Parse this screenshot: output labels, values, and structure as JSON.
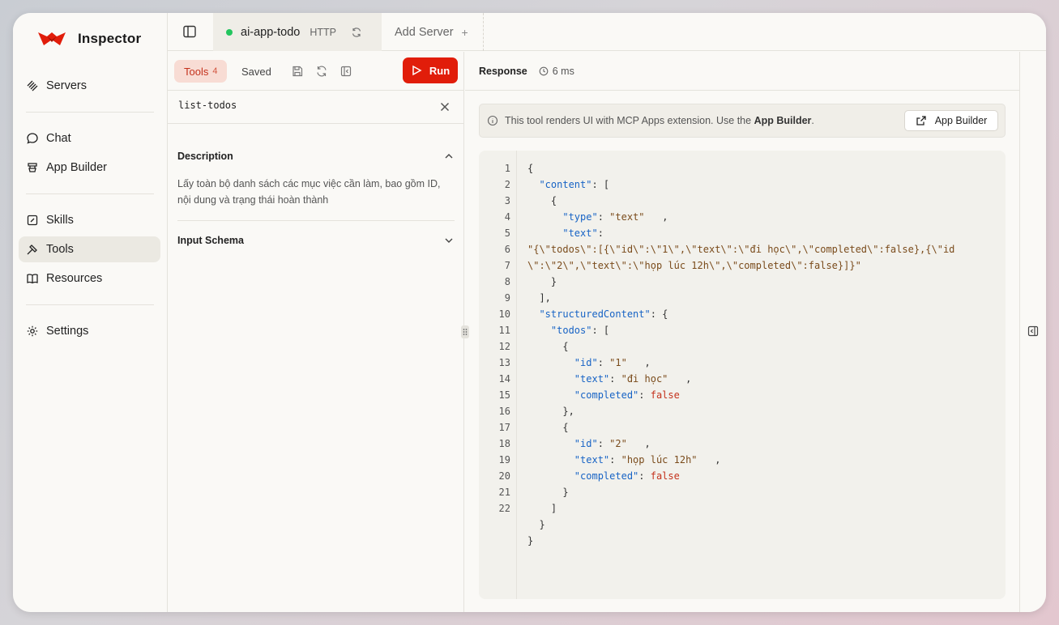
{
  "app": {
    "title": "Inspector"
  },
  "sidebar": {
    "groups": [
      [
        {
          "label": "Servers",
          "icon": "servers-icon"
        }
      ],
      [
        {
          "label": "Chat",
          "icon": "chat-icon"
        },
        {
          "label": "App Builder",
          "icon": "app-builder-icon"
        }
      ],
      [
        {
          "label": "Skills",
          "icon": "skills-icon"
        },
        {
          "label": "Tools",
          "icon": "tools-icon",
          "active": true
        },
        {
          "label": "Resources",
          "icon": "book-icon"
        }
      ],
      [
        {
          "label": "Settings",
          "icon": "gear-icon"
        }
      ]
    ]
  },
  "topbar": {
    "server_name": "ai-app-todo",
    "server_protocol": "HTTP",
    "add_server_label": "Add Server",
    "add_server_plus": "+"
  },
  "left_panel": {
    "tabs": {
      "tools_label": "Tools",
      "tools_count": "4",
      "saved_label": "Saved"
    },
    "run_label": "Run",
    "tool_name": "list-todos",
    "description_title": "Description",
    "description_text": "Lấy toàn bộ danh sách các mục việc cần làm, bao gồm ID, nội dung và trạng thái hoàn thành",
    "input_schema_title": "Input Schema"
  },
  "response": {
    "title": "Response",
    "time": "6 ms",
    "info_text": "This tool renders UI with MCP Apps extension. Use the ",
    "info_link": "App Builder",
    "info_end": ".",
    "app_builder_button": "App Builder",
    "lines": [
      "{",
      "  \"content\": [",
      "    {",
      "      \"type\": \"text\"   ,",
      "      \"text\":",
      "\"{\\\"todos\\\":[{\\\"id\\\":\\\"1\\\",\\\"text\\\":\\\"đi học\\\",\\\"completed\\\":false},{\\\"id",
      "\\\":\\\"2\\\",\\\"text\\\":\\\"họp lúc 12h\\\",\\\"completed\\\":false}]}\"",
      "    }",
      "  ],",
      "  \"structuredContent\": {",
      "    \"todos\": [",
      "      {",
      "        \"id\": \"1\"   ,",
      "        \"text\": \"đi học\"   ,",
      "        \"completed\": false",
      "      },",
      "      {",
      "        \"id\": \"2\"   ,",
      "        \"text\": \"họp lúc 12h\"   ,",
      "        \"completed\": false",
      "      }",
      "    ]",
      "  }",
      "}"
    ],
    "line_numbers": [
      "1",
      "2",
      "3",
      "4",
      "5",
      "6",
      "7",
      "8",
      "9",
      "10",
      "11",
      "12",
      "13",
      "14",
      "15",
      "16",
      "17",
      "18",
      "19",
      "20",
      "21",
      "22",
      "",
      ""
    ]
  },
  "colors": {
    "accent": "#e11d0a",
    "status_online": "#22c55e",
    "json_key": "#1763c5",
    "json_string": "#7a4b1b",
    "json_bool": "#c4321c"
  }
}
